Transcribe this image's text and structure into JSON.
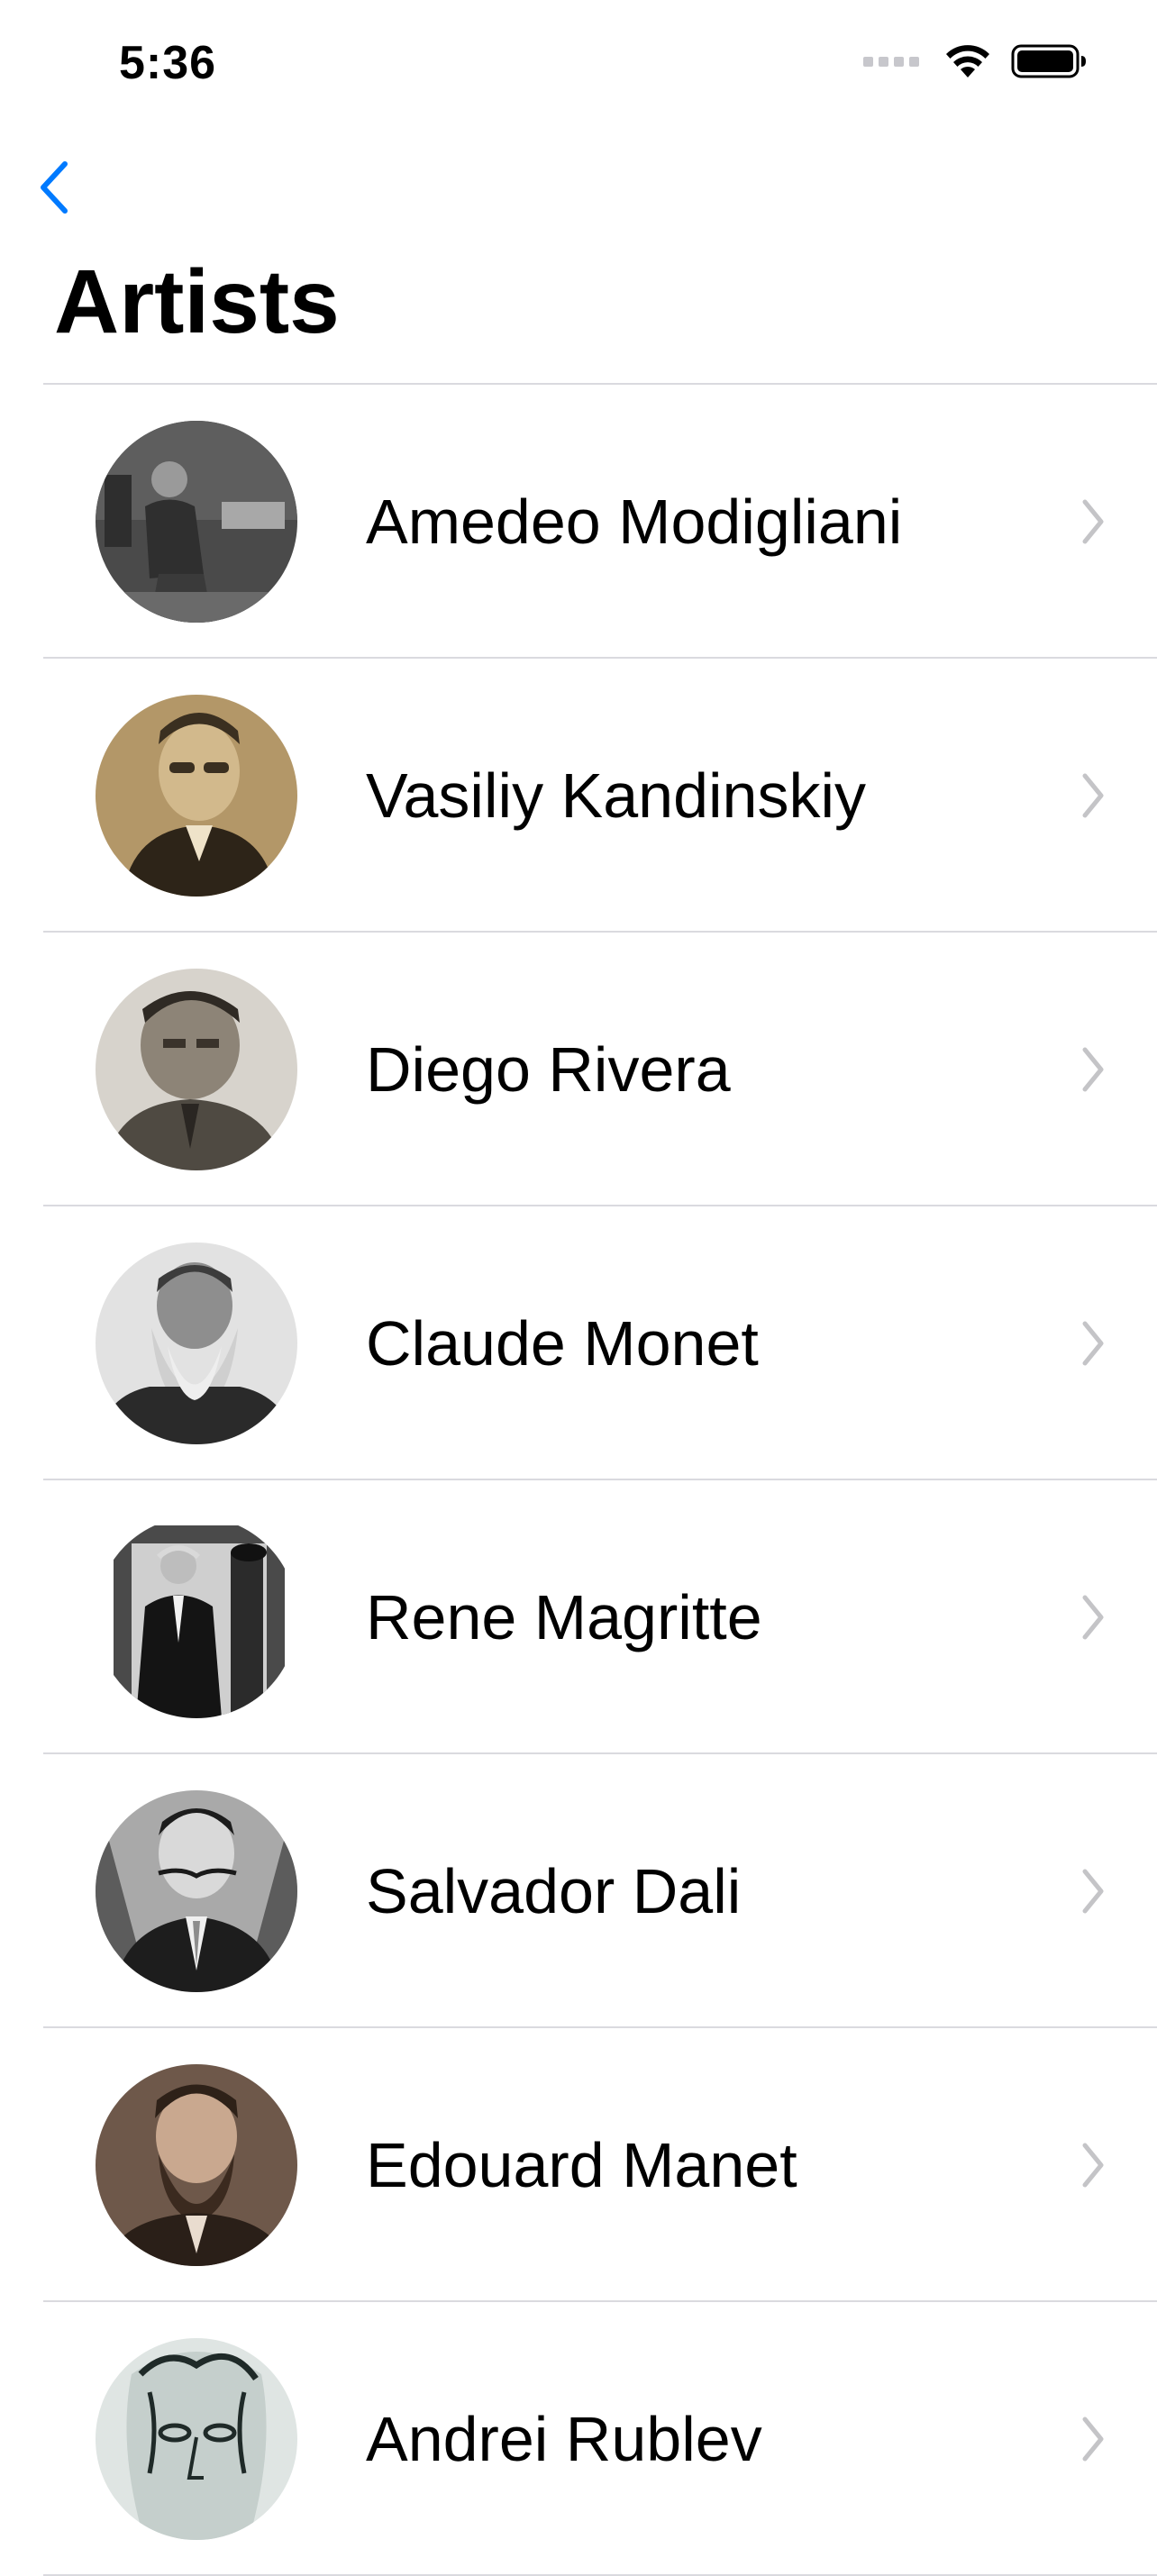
{
  "status_bar": {
    "time": "5:36",
    "icons": [
      "cellular-signal-icon",
      "wifi-icon",
      "battery-icon"
    ]
  },
  "nav": {
    "back_icon": "chevron-left-icon",
    "title": "Artists"
  },
  "colors": {
    "accent": "#007AFF",
    "separator": "#DADADF",
    "chevron": "#C4C4C7",
    "text": "#000000"
  },
  "artists": [
    {
      "name": "Amedeo Modigliani",
      "photo_tone": "#6e6e6e"
    },
    {
      "name": "Vasiliy Kandinskiy",
      "photo_tone": "#8f7449"
    },
    {
      "name": "Diego Rivera",
      "photo_tone": "#8a8378"
    },
    {
      "name": "Claude Monet",
      "photo_tone": "#7d7d7d"
    },
    {
      "name": "Rene Magritte",
      "photo_tone": "#5b5b5b"
    },
    {
      "name": "Salvador Dali",
      "photo_tone": "#747474"
    },
    {
      "name": "Edouard Manet",
      "photo_tone": "#6b5546"
    },
    {
      "name": "Andrei Rublev",
      "photo_tone": "#b9c2c0"
    }
  ]
}
